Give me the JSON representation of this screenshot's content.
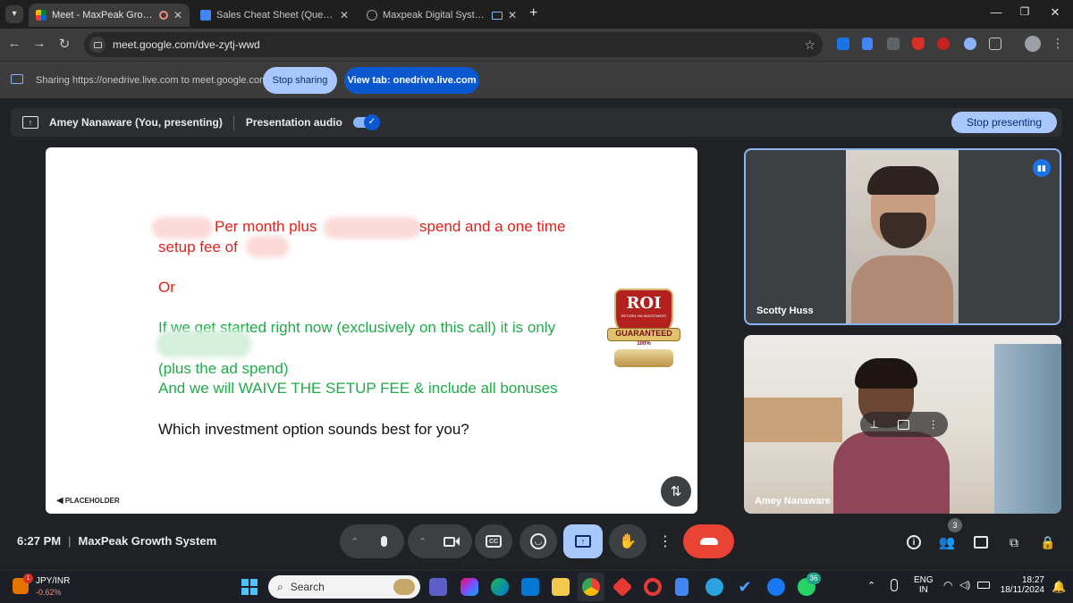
{
  "browser": {
    "tabs": [
      {
        "title": "Meet - MaxPeak Growth Sy",
        "active": true,
        "icon": "meet-icon"
      },
      {
        "title": "Sales Cheat Sheet (Questions)",
        "active": false,
        "icon": "docs-icon"
      },
      {
        "title": "Maxpeak Digital System Cre",
        "active": false,
        "icon": "globe-icon"
      }
    ],
    "url": "meet.google.com/dve-zytj-wwd"
  },
  "sharebar": {
    "message": "Sharing https://onedrive.live.com to meet.google.com",
    "stop_sharing": "Stop sharing",
    "view_tab": "View tab: onedrive.live.com"
  },
  "presenting_bar": {
    "presenter": "Amey Nanaware (You, presenting)",
    "audio_label": "Presentation audio",
    "audio_on": true,
    "stop_presenting": "Stop presenting"
  },
  "slide": {
    "line1": "Per month plus",
    "line1b": "spend and a one time",
    "line2": "setup fee of",
    "or": "Or",
    "green1": "If we get started right now (exclusively on this call) it is only",
    "green2": "(plus the ad spend)",
    "green3": "And we will WAIVE THE SETUP FEE & include all bonuses",
    "question": "Which investment option sounds best for you?",
    "footer_logo": "PLACEHOLDER",
    "badge": {
      "roi": "ROI",
      "sub": "RETURN ON INVESTMENT",
      "ribbon": "GUARANTEED",
      "pct": "100%"
    }
  },
  "participants": [
    {
      "name": "Scotty Huss",
      "speaking": true
    },
    {
      "name": "Amey Nanaware",
      "speaking": false
    }
  ],
  "meeting": {
    "time": "6:27 PM",
    "separator": "|",
    "name": "MaxPeak Growth System",
    "people_count": "3"
  },
  "taskbar": {
    "ticker_symbol": "JPY/INR",
    "ticker_change": "-0.62%",
    "ticker_badge": "1",
    "search_placeholder": "Search",
    "whatsapp_badge": "36",
    "lang1": "ENG",
    "lang2": "IN",
    "clock_time": "18:27",
    "clock_date": "18/11/2024"
  },
  "colors": {
    "meet_blue": "#8ab4f8",
    "end_call_red": "#ea4335",
    "slide_red": "#e0201b",
    "slide_green": "#1fab48"
  }
}
